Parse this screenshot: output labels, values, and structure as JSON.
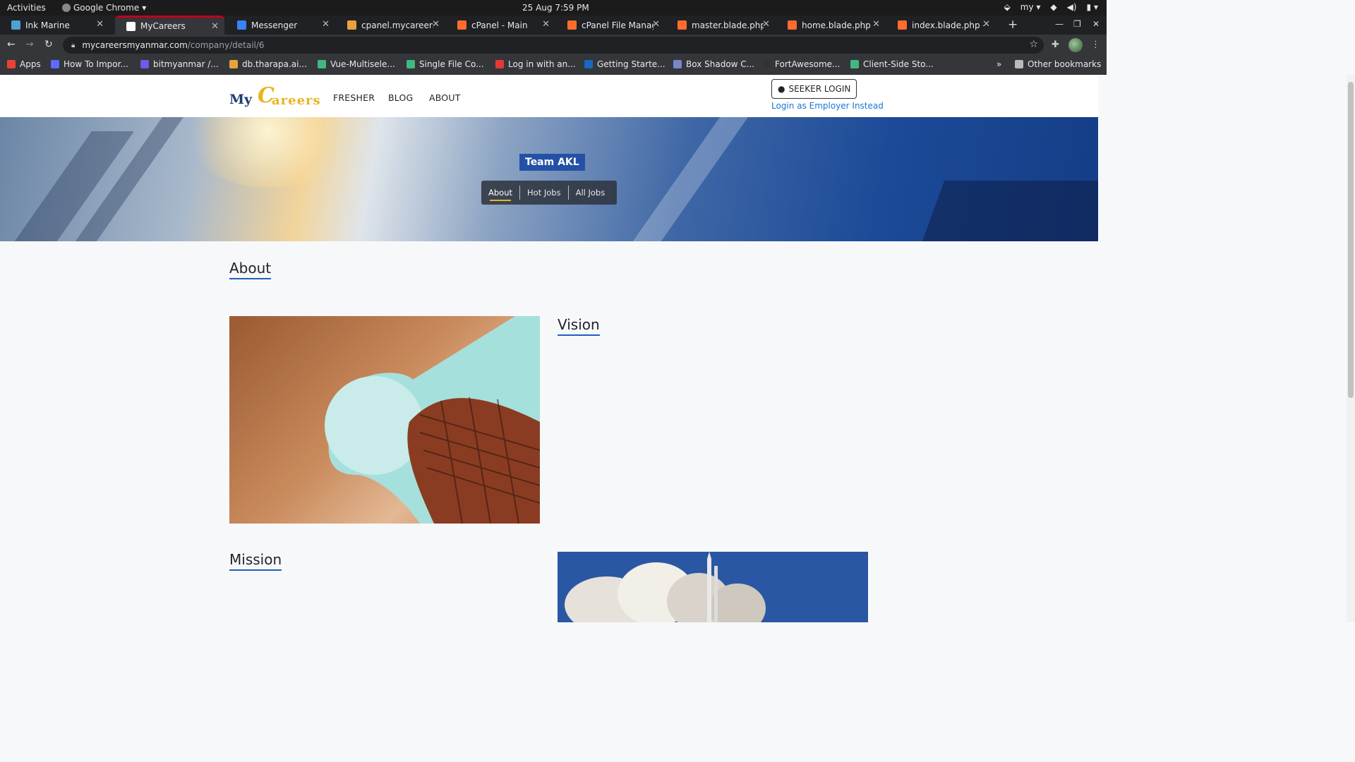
{
  "system_bar": {
    "activities": "Activities",
    "app_name": "Google Chrome",
    "clock": "25 Aug  7:59 PM",
    "keyboard_layout": "my"
  },
  "browser": {
    "tabs": [
      {
        "title": "Ink Marine",
        "icon": "globe-icon",
        "color": "#4ea1d3"
      },
      {
        "title": "MyCareers",
        "icon": "mycareers-favicon",
        "color": "#ffffff"
      },
      {
        "title": "Messenger",
        "icon": "messenger-icon",
        "color": "#3b82f6"
      },
      {
        "title": "cpanel.mycareersm",
        "icon": "cpanel-tree-icon",
        "color": "#e8a33d"
      },
      {
        "title": "cPanel - Main",
        "icon": "cpanel-icon",
        "color": "#ff6c2c"
      },
      {
        "title": "cPanel File Manage",
        "icon": "cpanel-icon",
        "color": "#ff6c2c"
      },
      {
        "title": "master.blade.php - c",
        "icon": "cpanel-icon",
        "color": "#ff6c2c"
      },
      {
        "title": "home.blade.php - c",
        "icon": "cpanel-icon",
        "color": "#ff6c2c"
      },
      {
        "title": "index.blade.php - c",
        "icon": "cpanel-icon",
        "color": "#ff6c2c"
      }
    ],
    "active_tab_index": 1,
    "url_host": "mycareersmyanmar.com",
    "url_path": "/company/detail/6",
    "bookmarks": [
      {
        "label": "Apps",
        "icon": "apps-grid-icon",
        "color": "#e94235"
      },
      {
        "label": "How To Impor...",
        "icon": "bookmark-favicon",
        "color": "#5b6cff"
      },
      {
        "label": "bitmyanmar /...",
        "icon": "bookmark-favicon",
        "color": "#6c5ce7"
      },
      {
        "label": "db.tharapa.ai...",
        "icon": "bookmark-favicon",
        "color": "#e8a33d"
      },
      {
        "label": "Vue-Multisele...",
        "icon": "vue-icon",
        "color": "#41b883"
      },
      {
        "label": "Single File Co...",
        "icon": "vue-icon",
        "color": "#41b883"
      },
      {
        "label": "Log in with an...",
        "icon": "bookmark-favicon",
        "color": "#e53935"
      },
      {
        "label": "Getting Starte...",
        "icon": "vuetify-icon",
        "color": "#1867c0"
      },
      {
        "label": "Box Shadow C...",
        "icon": "bookmark-favicon",
        "color": "#7986cb"
      },
      {
        "label": "FortAwesome...",
        "icon": "github-icon",
        "color": "#333333"
      },
      {
        "label": "Client-Side Sto...",
        "icon": "vue-icon",
        "color": "#41b883"
      }
    ],
    "overflow_label": "»",
    "other_bookmarks": "Other bookmarks"
  },
  "site": {
    "logo": {
      "my": "My",
      "c": "C",
      "rest": "areers"
    },
    "nav": [
      "FRESHER",
      "BLOG",
      "ABOUT"
    ],
    "seeker_login": "SEEKER LOGIN",
    "employer_link": "Login as Employer Instead",
    "company_name": "Team AKL",
    "company_tabs": [
      "About",
      "Hot Jobs",
      "All Jobs"
    ],
    "active_company_tab": "About",
    "sections": {
      "about": "About",
      "vision": "Vision",
      "mission": "Mission"
    }
  },
  "colors": {
    "brand_blue": "#1f3b73",
    "brand_gold": "#e8b422",
    "link_blue": "#1976d2",
    "badge_blue": "#2451a6",
    "active_tab_accent": "#c5001c"
  }
}
